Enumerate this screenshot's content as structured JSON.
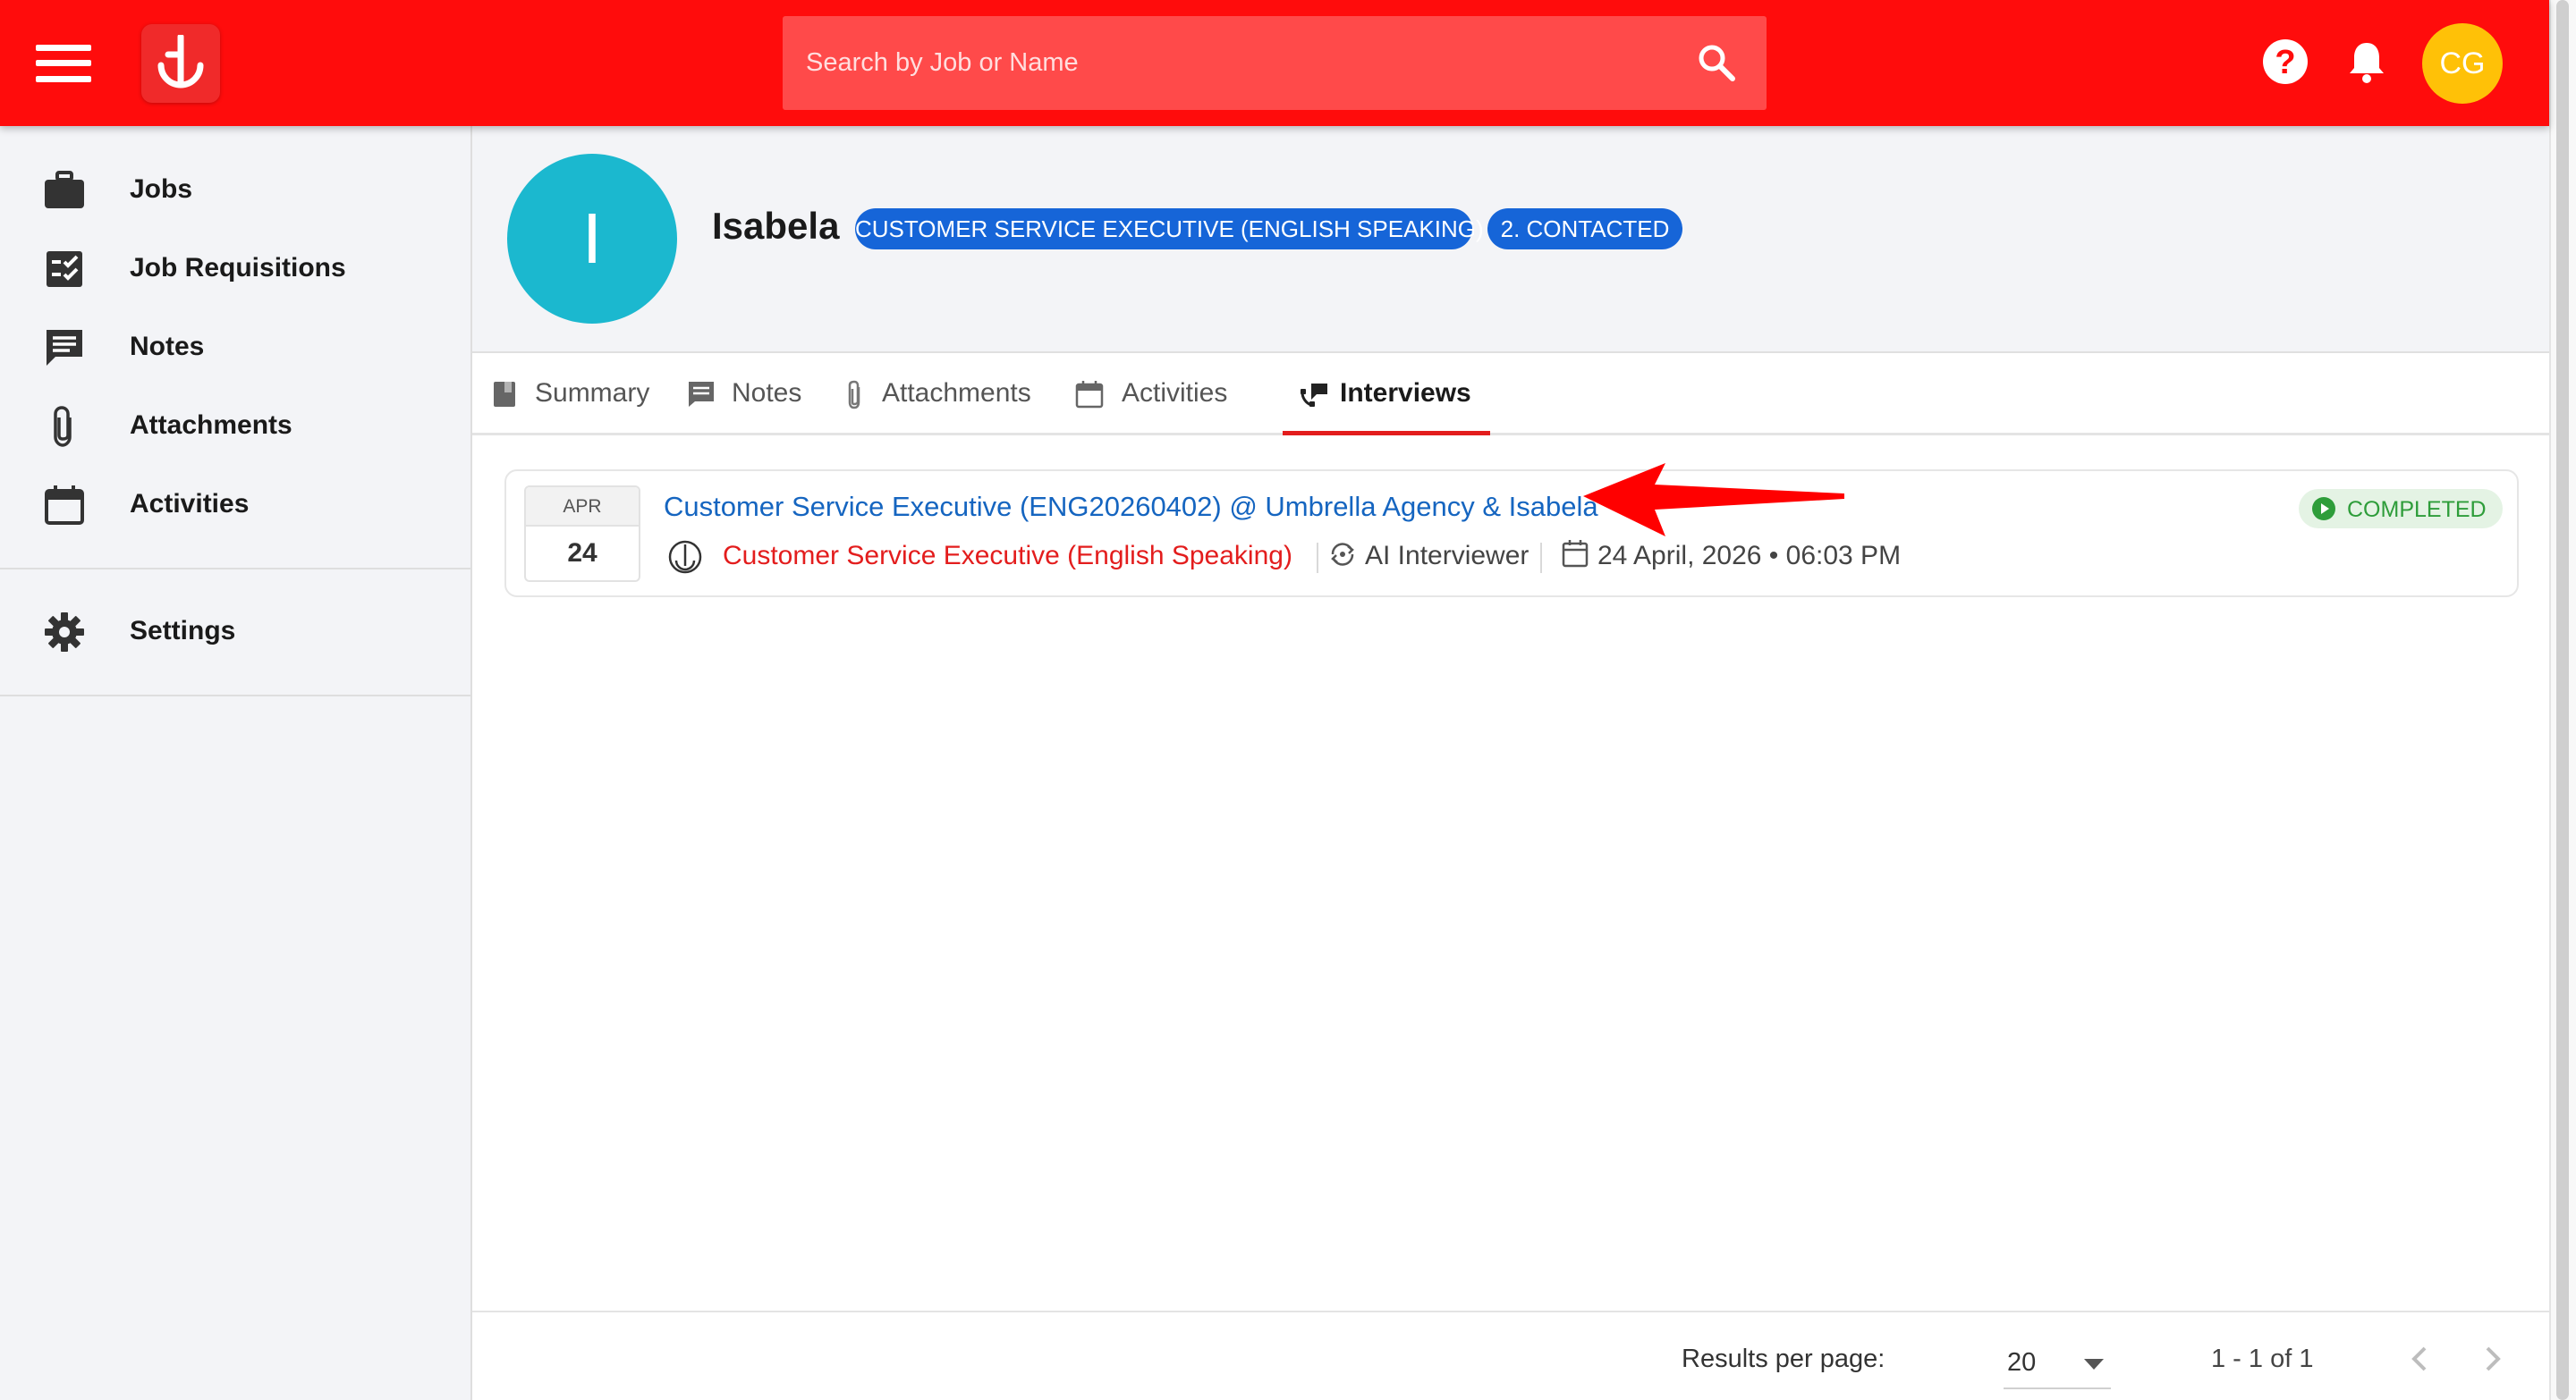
{
  "topbar": {
    "search_placeholder": "Search by Job or Name",
    "user_initials": "CG",
    "help_glyph": "?",
    "colors": {
      "bar": "#ff0c0c",
      "avatar": "#ffc107"
    }
  },
  "sidebar": {
    "items": [
      {
        "label": "Jobs",
        "icon": "briefcase-icon"
      },
      {
        "label": "Job Requisitions",
        "icon": "checklist-icon"
      },
      {
        "label": "Notes",
        "icon": "comment-icon"
      },
      {
        "label": "Attachments",
        "icon": "paperclip-icon"
      },
      {
        "label": "Activities",
        "icon": "calendar-icon"
      }
    ],
    "settings": {
      "label": "Settings",
      "icon": "gear-icon"
    }
  },
  "profile": {
    "initial": "I",
    "name": "Isabela",
    "job_badge": "CUSTOMER SERVICE EXECUTIVE (ENGLISH SPEAKING)",
    "stage_badge": "2. CONTACTED",
    "colors": {
      "avatar": "#1bb8cf",
      "badge": "#1665d8"
    }
  },
  "tabs": [
    {
      "label": "Summary",
      "icon": "bookmark-icon"
    },
    {
      "label": "Notes",
      "icon": "comment-icon"
    },
    {
      "label": "Attachments",
      "icon": "paperclip-icon"
    },
    {
      "label": "Activities",
      "icon": "calendar-icon"
    },
    {
      "label": "Interviews",
      "icon": "interview-icon",
      "active": true
    }
  ],
  "interview": {
    "month": "APR",
    "day": "24",
    "title": "Customer Service Executive (ENG20260402) @ Umbrella Agency & Isabela",
    "job": "Customer Service Executive (English Speaking)",
    "interviewer": "AI Interviewer",
    "datetime": "24 April, 2026 • 06:03 PM",
    "status": "COMPLETED",
    "colors": {
      "title": "#1565c0",
      "job": "#e31d1d",
      "status": "#2e9d3a"
    }
  },
  "footer": {
    "rpp_label": "Results per page:",
    "rpp_value": "20",
    "range": "1 - 1 of 1"
  }
}
